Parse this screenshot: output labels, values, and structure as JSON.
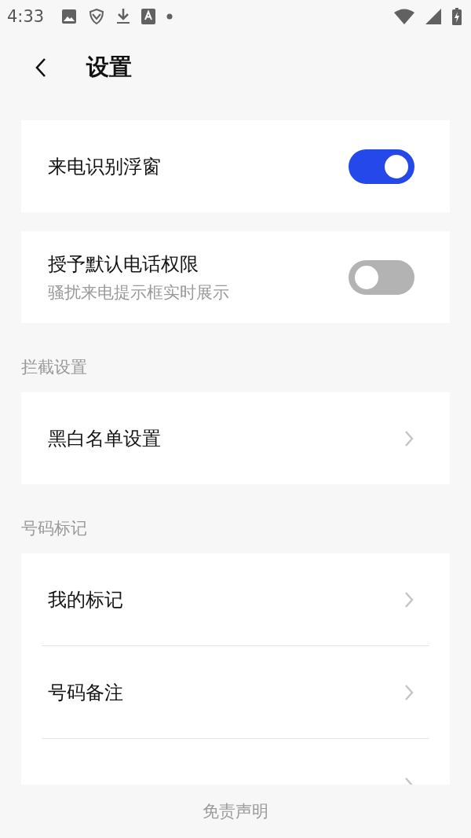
{
  "status_bar": {
    "time": "4:33"
  },
  "header": {
    "title": "设置"
  },
  "groups": [
    {
      "items": [
        {
          "kind": "toggle",
          "label": "来电识别浮窗",
          "on": true
        }
      ]
    },
    {
      "items": [
        {
          "kind": "toggle",
          "label": "授予默认电话权限",
          "subtitle": "骚扰来电提示框实时展示",
          "on": false
        }
      ]
    },
    {
      "heading": "拦截设置",
      "items": [
        {
          "kind": "link",
          "label": "黑白名单设置"
        }
      ]
    },
    {
      "heading": "号码标记",
      "items": [
        {
          "kind": "link",
          "label": "我的标记"
        },
        {
          "kind": "link",
          "label": "号码备注"
        },
        {
          "kind": "link"
        }
      ]
    }
  ],
  "footer": {
    "link": "免责声明"
  }
}
